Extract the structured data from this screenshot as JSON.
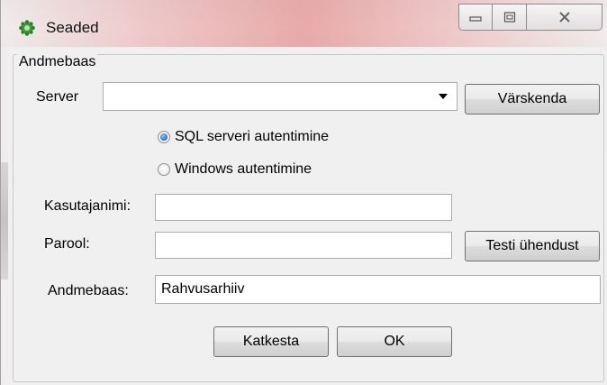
{
  "window": {
    "title": "Seaded",
    "app_icon": "gear-icon",
    "controls": {
      "minimize": "minimize-icon",
      "maximize": "maximize-icon",
      "close": "close-icon"
    }
  },
  "group": {
    "legend": "Andmebaas",
    "server_label": "Server",
    "server_value": "",
    "refresh_button": "Värskenda",
    "auth_sql": "SQL serveri autentimine",
    "auth_windows": "Windows autentimine",
    "auth_selected": "sql",
    "username_label": "Kasutajanimi:",
    "username_value": "",
    "password_label": "Parool:",
    "password_value": "",
    "test_button": "Testi ühendust",
    "database_label": "Andmebaas:",
    "database_value": "Rahvusarhiiv"
  },
  "footer": {
    "cancel_button": "Katkesta",
    "ok_button": "OK"
  },
  "colors": {
    "radio_selected": "#2a6fb8",
    "app_icon_green": "#3b9b3b"
  }
}
